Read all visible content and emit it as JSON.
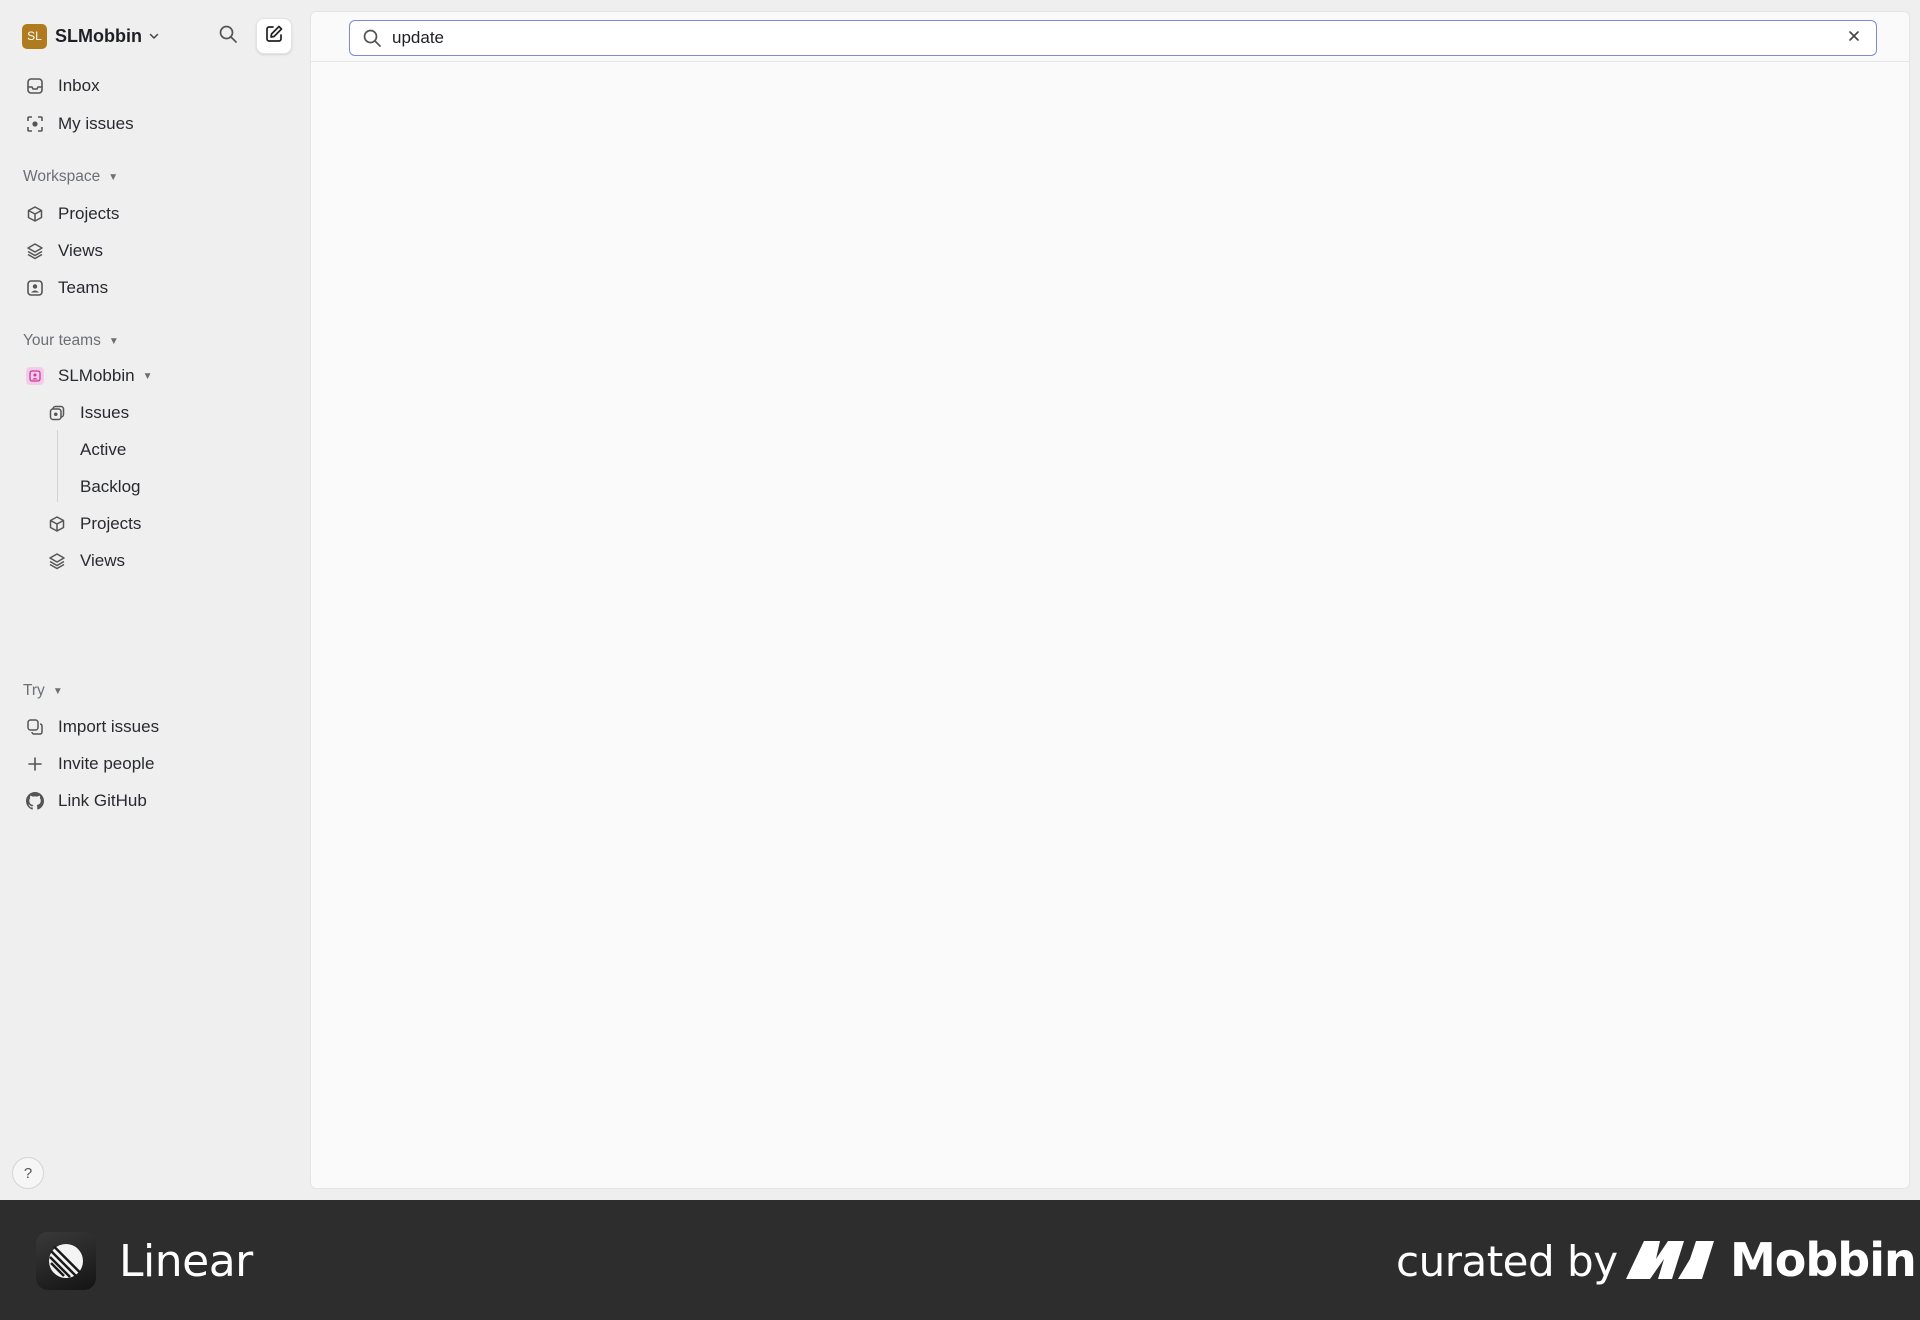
{
  "workspace": {
    "initials": "SL",
    "name": "SLMobbin"
  },
  "nav": {
    "inbox": "Inbox",
    "my_issues": "My issues"
  },
  "workspace_section": {
    "label": "Workspace",
    "items": [
      "Projects",
      "Views",
      "Teams"
    ]
  },
  "teams_section": {
    "label": "Your teams",
    "team_name": "SLMobbin",
    "items": [
      "Issues",
      "Active",
      "Backlog",
      "Projects",
      "Views"
    ]
  },
  "try_section": {
    "label": "Try",
    "items": [
      "Import issues",
      "Invite people",
      "Link GitHub"
    ]
  },
  "help": {
    "label": "?"
  },
  "search": {
    "value": "update"
  },
  "footer": {
    "app_name": "Linear",
    "curated_by": "curated by",
    "brand": "Mobbin"
  },
  "colors": {
    "workspace_avatar": "#b07a1e",
    "team_icon": "#f3cde8",
    "search_focus": "#7b8bd6",
    "footer_bg": "#2d2d2d"
  }
}
